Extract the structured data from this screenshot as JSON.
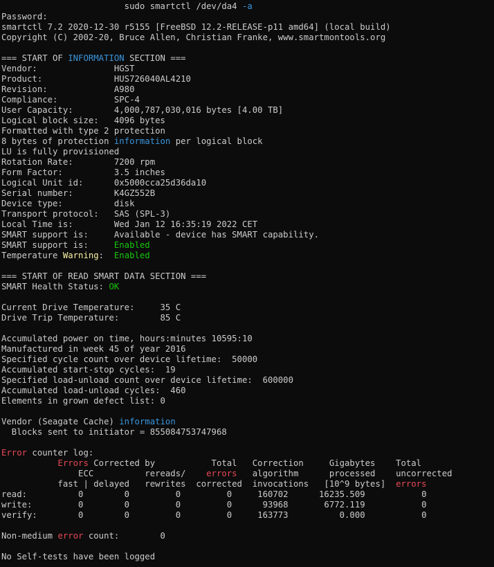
{
  "terminal": {
    "lines": [
      [
        {
          "t": "                        sudo smartctl /dev/da4 "
        },
        {
          "t": "-a",
          "c": "blue"
        }
      ],
      [
        {
          "t": "Password:"
        }
      ],
      [
        {
          "t": "smartctl 7.2 2020-12-30 r5155 [FreeBSD 12.2-RELEASE-p11 amd64] (local build)"
        }
      ],
      [
        {
          "t": "Copyright (C) 2002-20, Bruce Allen, Christian Franke, www.smartmontools.org"
        }
      ],
      [
        {
          "t": ""
        }
      ],
      [
        {
          "t": "=== START OF "
        },
        {
          "t": "INFORMATION",
          "c": "blue"
        },
        {
          "t": " SECTION ==="
        }
      ],
      [
        {
          "t": "Vendor:               HGST"
        }
      ],
      [
        {
          "t": "Product:              HUS726040AL4210"
        }
      ],
      [
        {
          "t": "Revision:             A980"
        }
      ],
      [
        {
          "t": "Compliance:           SPC-4"
        }
      ],
      [
        {
          "t": "User Capacity:        4,000,787,030,016 bytes [4.00 TB]"
        }
      ],
      [
        {
          "t": "Logical block size:   4096 bytes"
        }
      ],
      [
        {
          "t": "Formatted with type 2 protection"
        }
      ],
      [
        {
          "t": "8 bytes of protection "
        },
        {
          "t": "information",
          "c": "blue"
        },
        {
          "t": " per logical block"
        }
      ],
      [
        {
          "t": "LU is fully provisioned"
        }
      ],
      [
        {
          "t": "Rotation Rate:        7200 rpm"
        }
      ],
      [
        {
          "t": "Form Factor:          3.5 inches"
        }
      ],
      [
        {
          "t": "Logical Unit id:      0x5000cca25d36da10"
        }
      ],
      [
        {
          "t": "Serial number:        K4GZ552B"
        }
      ],
      [
        {
          "t": "Device type:          disk"
        }
      ],
      [
        {
          "t": "Transport protocol:   SAS (SPL-3)"
        }
      ],
      [
        {
          "t": "Local Time is:        Wed Jan 12 16:35:19 2022 CET"
        }
      ],
      [
        {
          "t": "SMART support is:     Available - device has SMART capability."
        }
      ],
      [
        {
          "t": "SMART support is:     "
        },
        {
          "t": "Enabled",
          "c": "green"
        }
      ],
      [
        {
          "t": "Temperature "
        },
        {
          "t": "Warning",
          "c": "yellow"
        },
        {
          "t": ":  "
        },
        {
          "t": "Enabled",
          "c": "green"
        }
      ],
      [
        {
          "t": ""
        }
      ],
      [
        {
          "t": "=== START OF READ SMART DATA SECTION ==="
        }
      ],
      [
        {
          "t": "SMART Health Status: "
        },
        {
          "t": "OK",
          "c": "green"
        }
      ],
      [
        {
          "t": ""
        }
      ],
      [
        {
          "t": "Current Drive Temperature:     35 C"
        }
      ],
      [
        {
          "t": "Drive Trip Temperature:        85 C"
        }
      ],
      [
        {
          "t": ""
        }
      ],
      [
        {
          "t": "Accumulated power on time, hours:minutes 10595:10"
        }
      ],
      [
        {
          "t": "Manufactured in week 45 of year 2016"
        }
      ],
      [
        {
          "t": "Specified cycle count over device lifetime:  50000"
        }
      ],
      [
        {
          "t": "Accumulated start-stop cycles:  19"
        }
      ],
      [
        {
          "t": "Specified load-unload count over device lifetime:  600000"
        }
      ],
      [
        {
          "t": "Accumulated load-unload cycles:  460"
        }
      ],
      [
        {
          "t": "Elements in grown defect list: 0"
        }
      ],
      [
        {
          "t": ""
        }
      ],
      [
        {
          "t": "Vendor (Seagate Cache) "
        },
        {
          "t": "information",
          "c": "blue"
        }
      ],
      [
        {
          "t": "  Blocks sent to initiator = 855084753747968"
        }
      ],
      [
        {
          "t": ""
        }
      ],
      [
        {
          "t": "Error",
          "c": "red"
        },
        {
          "t": " counter log:"
        }
      ],
      [
        {
          "t": "           "
        },
        {
          "t": "Errors",
          "c": "red"
        },
        {
          "t": " Corrected by           Total   Correction     Gigabytes    Total"
        }
      ],
      [
        {
          "t": "               ECC          rereads/    "
        },
        {
          "t": "errors",
          "c": "red"
        },
        {
          "t": "   algorithm      processed    uncorrected"
        }
      ],
      [
        {
          "t": "           fast | delayed   rewrites  corrected  invocations   [10^9 bytes]  "
        },
        {
          "t": "errors",
          "c": "red"
        }
      ],
      [
        {
          "t": "read:          0        0         0         0     160702      16235.509           0"
        }
      ],
      [
        {
          "t": "write:         0        0         0         0      93968       6772.119           0"
        }
      ],
      [
        {
          "t": "verify:        0        0         0         0     163773          0.000           0"
        }
      ],
      [
        {
          "t": ""
        }
      ],
      [
        {
          "t": "Non-medium "
        },
        {
          "t": "error",
          "c": "red"
        },
        {
          "t": " count:        0"
        }
      ],
      [
        {
          "t": ""
        }
      ],
      [
        {
          "t": "No Self-tests have been logged"
        }
      ]
    ]
  },
  "colors": {
    "background": "#0c0c0c",
    "foreground": "#cccccc",
    "blue": "#3a96dd",
    "green": "#16c60c",
    "yellow": "#f9f1a5",
    "red": "#e74856"
  }
}
